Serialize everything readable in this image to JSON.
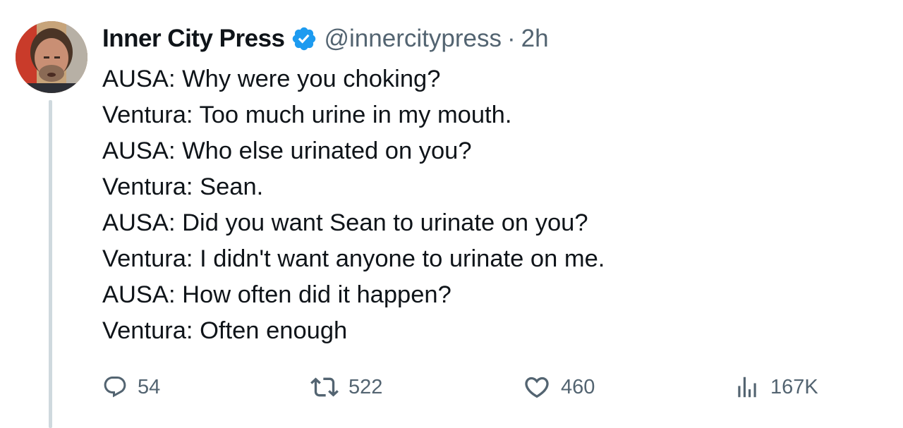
{
  "tweet": {
    "display_name": "Inner City Press",
    "handle": "@innercitypress",
    "separator": "·",
    "time": "2h",
    "lines": [
      "AUSA: Why were you choking?",
      "Ventura: Too much urine in my mouth.",
      "AUSA: Who else urinated on you?",
      "Ventura: Sean.",
      "AUSA: Did you want Sean to urinate on you?",
      "Ventura: I didn't want anyone to urinate on me.",
      "AUSA: How often did it happen?",
      "Ventura: Often enough"
    ],
    "stats": {
      "replies": "54",
      "reposts": "522",
      "likes": "460",
      "views": "167K"
    }
  },
  "icons": {
    "verified": "verified-badge-icon",
    "reply": "reply-icon",
    "repost": "repost-icon",
    "like": "heart-icon",
    "views": "views-chart-icon"
  },
  "colors": {
    "verified_blue": "#1d9bf0",
    "text_primary": "#0f1419",
    "text_secondary": "#536471",
    "thread_line": "#cfd9de"
  }
}
